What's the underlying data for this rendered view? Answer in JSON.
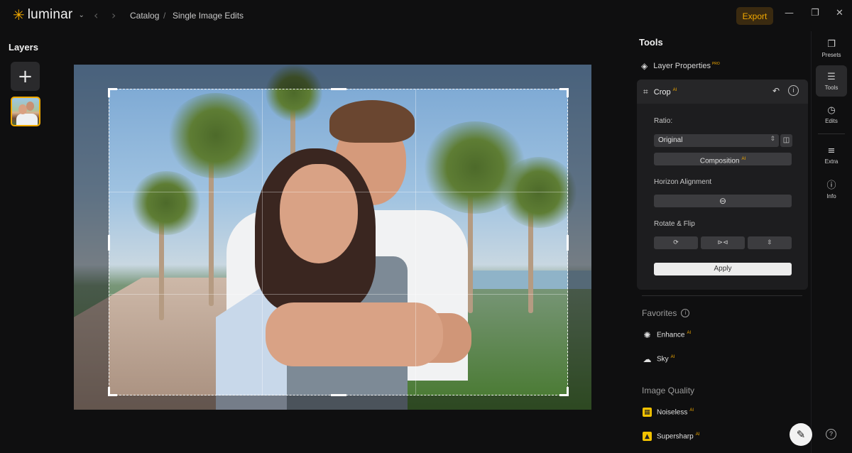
{
  "app": {
    "name": "luminar",
    "logo_icon": "sun-icon"
  },
  "breadcrumb": {
    "item1": "Catalog",
    "sep": "/",
    "item2": "Single Image Edits"
  },
  "header": {
    "export_label": "Export"
  },
  "layers": {
    "title": "Layers",
    "add_icon": "+"
  },
  "tools": {
    "title": "Tools",
    "layer_properties": {
      "label": "Layer Properties",
      "badge": "PRO"
    },
    "crop": {
      "label": "Crop",
      "badge": "AI",
      "ratio_label": "Ratio:",
      "ratio_value": "Original",
      "composition_label": "Composition",
      "composition_badge": "AI",
      "horizon_label": "Horizon Alignment",
      "rotate_label": "Rotate & Flip",
      "apply_label": "Apply"
    },
    "favorites": {
      "title": "Favorites",
      "items": [
        {
          "label": "Enhance",
          "badge": "AI",
          "icon": "sparkle-icon"
        },
        {
          "label": "Sky",
          "badge": "AI",
          "icon": "cloud-icon"
        }
      ]
    },
    "image_quality": {
      "title": "Image Quality",
      "items": [
        {
          "label": "Noiseless",
          "badge": "AI",
          "icon": "noiseless-icon"
        },
        {
          "label": "Supersharp",
          "badge": "AI",
          "icon": "supersharp-icon"
        }
      ]
    }
  },
  "rail": {
    "items": [
      {
        "label": "Presets",
        "icon": "presets-icon"
      },
      {
        "label": "Tools",
        "icon": "sliders-icon"
      },
      {
        "label": "Edits",
        "icon": "history-icon"
      },
      {
        "label": "Extra",
        "icon": "list-icon"
      },
      {
        "label": "Info",
        "icon": "info-icon"
      }
    ]
  },
  "colors": {
    "accent": "#f2a900",
    "background": "#0f0f10",
    "panel": "#1d1d1f"
  }
}
